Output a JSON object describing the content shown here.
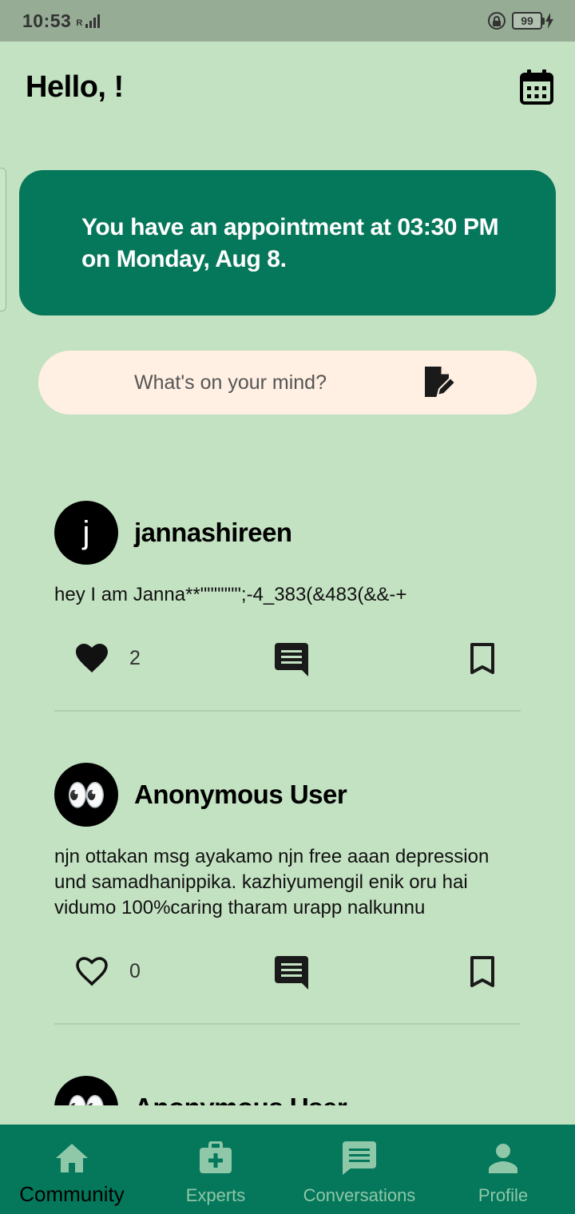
{
  "status_bar": {
    "time": "10:53",
    "network": "R",
    "battery": "99"
  },
  "header": {
    "greeting": "Hello, !"
  },
  "appointment": {
    "text": "You have an appointment at 03:30 PM on Monday, Aug 8."
  },
  "compose": {
    "placeholder": "What's on your mind?"
  },
  "posts": [
    {
      "avatar": "j",
      "username": "jannashireen",
      "body": "hey I am Janna**\"\"\"\"\"\";-4_383(&483(&&-+",
      "likes": "2",
      "liked": true
    },
    {
      "avatar": "👀",
      "username": "Anonymous User",
      "body": "njn ottakan msg ayakamo njn free aaan depression und samadhanippika. kazhiyumengil enik oru hai vidumo 100%caring tharam urapp nalkunnu",
      "likes": "0",
      "liked": false
    },
    {
      "avatar": "👀",
      "username": "Anonymous User"
    }
  ],
  "nav": [
    {
      "label": "Community",
      "icon": "home-icon",
      "active": true
    },
    {
      "label": "Experts",
      "icon": "medical-kit-icon",
      "active": false
    },
    {
      "label": "Conversations",
      "icon": "chat-icon",
      "active": false
    },
    {
      "label": "Profile",
      "icon": "person-icon",
      "active": false
    }
  ],
  "colors": {
    "background": "#c3e2c2",
    "primary": "#05775a",
    "compose_bg": "#fff0e3",
    "nav_inactive": "#8fc7a9"
  }
}
